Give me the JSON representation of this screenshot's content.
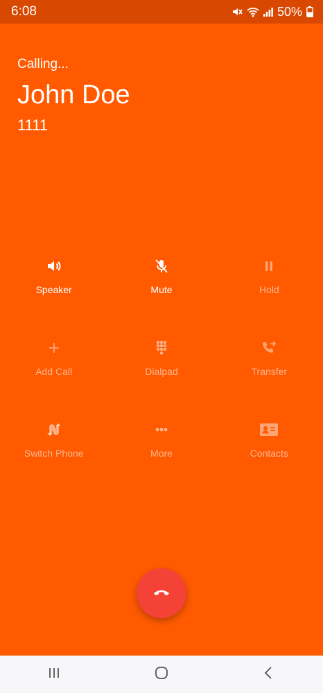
{
  "status": {
    "time": "6:08",
    "battery": "50%"
  },
  "call": {
    "state": "Calling...",
    "name": "John Doe",
    "number": "1111"
  },
  "buttons": {
    "speaker": "Speaker",
    "mute": "Mute",
    "hold": "Hold",
    "add_call": "Add Call",
    "dialpad": "Dialpad",
    "transfer": "Transfer",
    "switch_phone": "Switch Phone",
    "more": "More",
    "contacts": "Contacts"
  },
  "icons": {
    "speaker": "speaker-icon",
    "mute": "mic-off-icon",
    "hold": "pause-icon",
    "add_call": "plus-icon",
    "dialpad": "dialpad-icon",
    "transfer": "phone-forward-icon",
    "switch_phone": "switch-phone-icon",
    "more": "more-icon",
    "contacts": "contacts-icon",
    "hangup": "end-call-icon"
  },
  "colors": {
    "background": "#FF5A00",
    "status_bar": "#D94800",
    "hangup": "#F44336",
    "nav_bar": "#F7F7F9"
  }
}
